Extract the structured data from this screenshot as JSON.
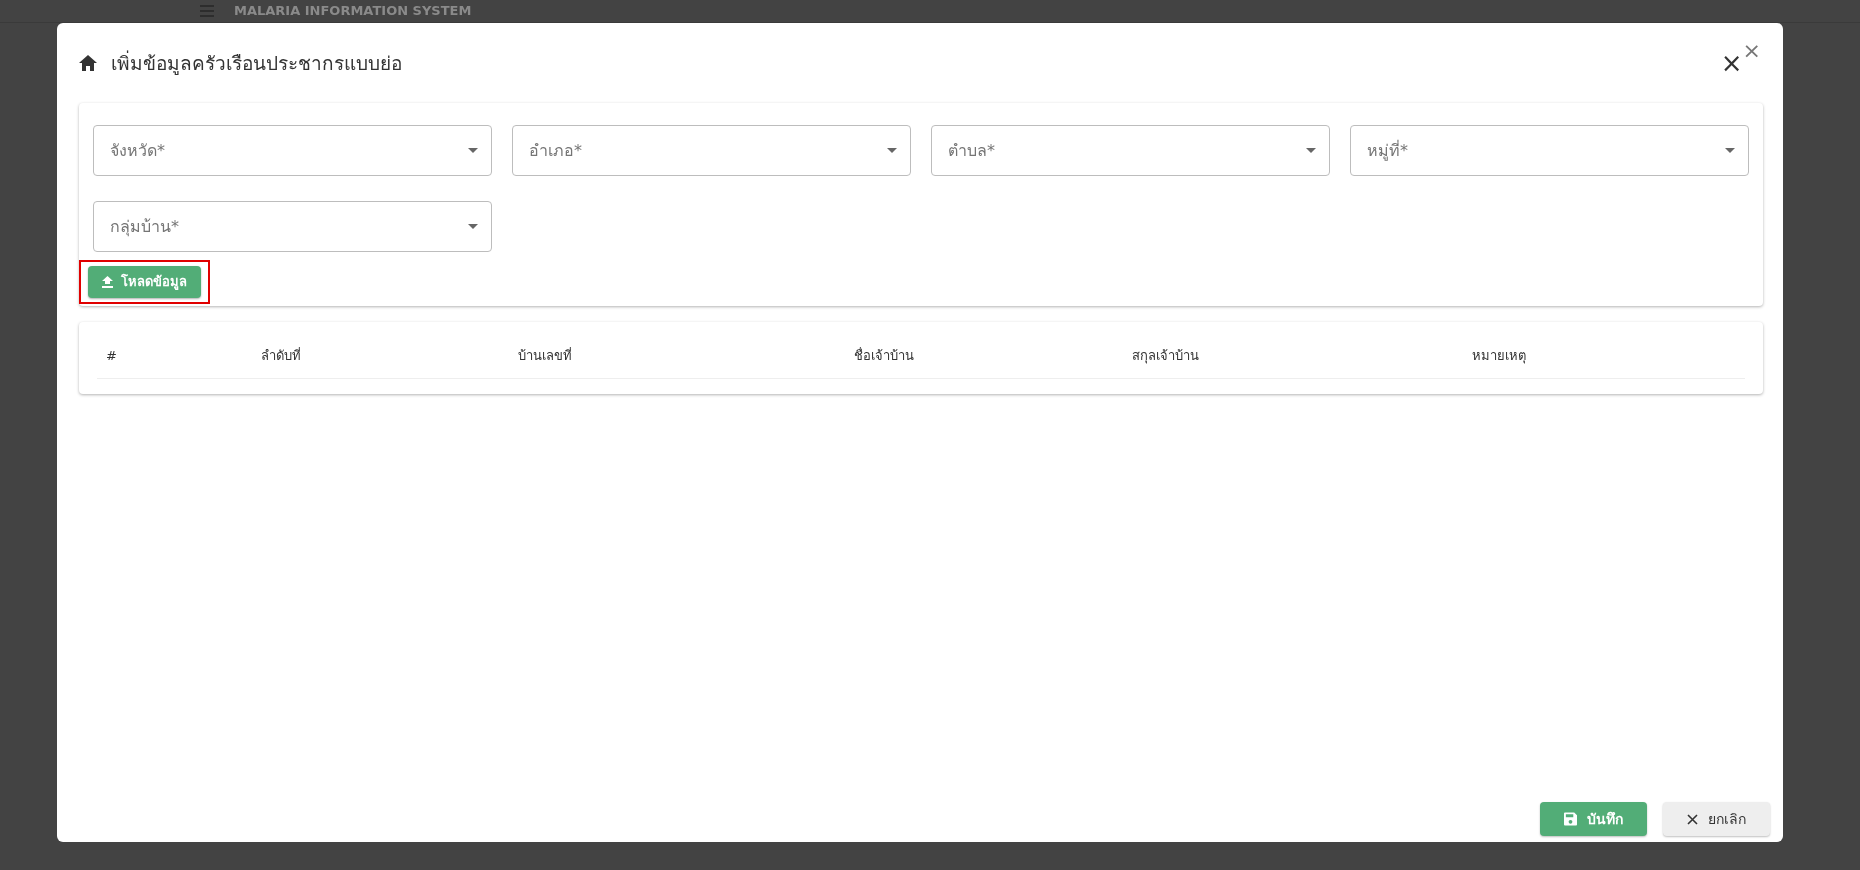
{
  "background": {
    "app_title": "MALARIA INFORMATION SYSTEM"
  },
  "dialog": {
    "title": "เพิ่มข้อมูลครัวเรือนประชากรแบบย่อ",
    "close_buttons": [
      "×",
      "×"
    ],
    "fields": [
      {
        "placeholder": "จังหวัด*"
      },
      {
        "placeholder": "อำเภอ*"
      },
      {
        "placeholder": "ตำบล*"
      },
      {
        "placeholder": "หมู่ที่*"
      },
      {
        "placeholder": "กลุ่มบ้าน*"
      }
    ],
    "load_button": {
      "label": "โหลดข้อมูล",
      "highlighted": true
    },
    "table": {
      "columns": [
        "#",
        "ลำดับที่",
        "บ้านเลขที่",
        "ชื่อเจ้าบ้าน",
        "สกุลเจ้าบ้าน",
        "หมายเหตุ"
      ]
    },
    "footer_buttons": [
      {
        "kind": "save",
        "label": "บันทึก"
      },
      {
        "kind": "cancel",
        "label": "ยกเลิก"
      }
    ]
  }
}
